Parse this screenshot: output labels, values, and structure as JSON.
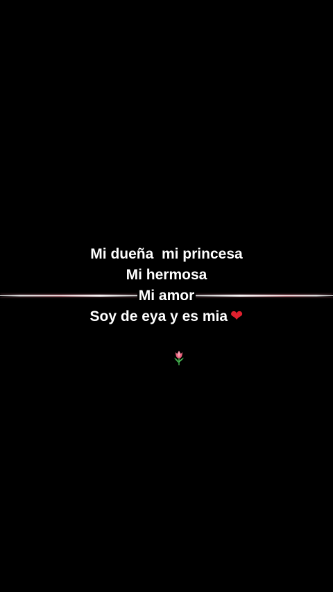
{
  "caption": {
    "line1": "Mi dueña  mi princesa",
    "line2": "Mi hermosa",
    "line3": "Mi amor",
    "line4": "Soy de eya y es mia",
    "line4_emoji": "heart-icon",
    "line5_emoji": "tulip-icon"
  },
  "colors": {
    "background": "#000000",
    "text": "#ffffff",
    "heart": "#e0202e",
    "tulip_petal": "#e8607a",
    "tulip_leaf": "#3ea64a",
    "glow_line": "#e696a0"
  },
  "icons": {
    "heart": "❤",
    "tulip": "tulip-icon"
  }
}
